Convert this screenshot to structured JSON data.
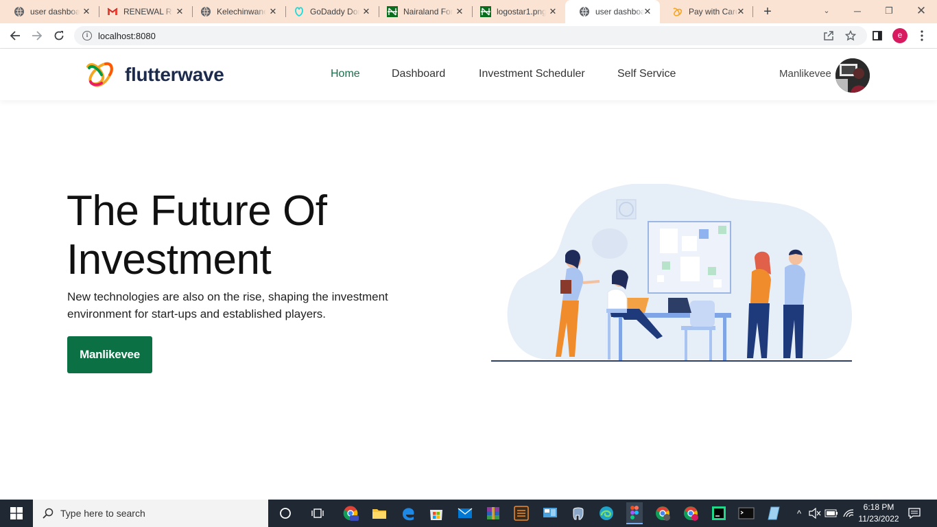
{
  "browser": {
    "tabs": [
      {
        "title": "user dashboard",
        "favicon": "globe-icon"
      },
      {
        "title": "RENEWAL REMINDER",
        "favicon": "gmail-icon"
      },
      {
        "title": "Kelechinwane",
        "favicon": "globe-icon"
      },
      {
        "title": "GoDaddy Domain",
        "favicon": "godaddy-icon"
      },
      {
        "title": "Nairaland Forum",
        "favicon": "nairaland-icon"
      },
      {
        "title": "logostar1.png",
        "favicon": "nairaland-icon"
      },
      {
        "title": "user dashboard",
        "favicon": "globe-icon"
      },
      {
        "title": "Pay with Card",
        "favicon": "flutterwave-icon"
      }
    ],
    "active_tab_index": 6,
    "url": "localhost:8080",
    "profile_initial": "e"
  },
  "site": {
    "brand": "flutterwave",
    "nav": [
      {
        "label": "Home",
        "active": true
      },
      {
        "label": "Dashboard",
        "active": false
      },
      {
        "label": "Investment Scheduler",
        "active": false
      },
      {
        "label": "Self Service",
        "active": false
      }
    ],
    "username": "Manlikevee",
    "hero": {
      "title_line1": "The Future Of",
      "title_line2": "Investment",
      "subtitle": "New technologies are also on the rise, shaping the investment environment for start-ups and established players.",
      "cta_label": "Manlikevee"
    },
    "accent": "#0b7044"
  },
  "taskbar": {
    "search_placeholder": "Type here to search",
    "time": "6:18 PM",
    "date": "11/23/2022"
  }
}
